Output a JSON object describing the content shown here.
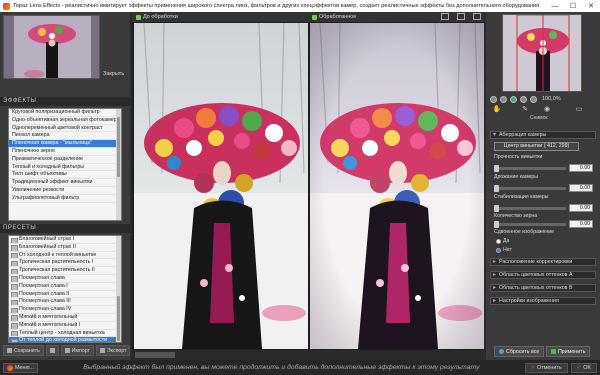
{
  "window": {
    "title": "Topaz Lens Effects - реалистично имитирует эффекты применения широкого спектра линз, фильтров и других спецэффектов камер, создает реалистичные эффекты без дополнительного оборудования.",
    "minimize": "—",
    "maximize": "☐",
    "close": "✕"
  },
  "left": {
    "close_label": "Закрыть",
    "effects_header": "ЭФФЕКТЫ",
    "effects": [
      "Круговой поляризационный фильтр",
      "Одно-объективная зеркальная фотокамера",
      "Однопеременный цветовой контраст",
      "Пинхол камера",
      "Пленочная камера - \"мыльница\"",
      "Пленочное зерно",
      "Призматическое разделение",
      "Теплый и холодный фильтры",
      "Тилт шифт объективы",
      "Традиционный эффект виньетки",
      "Увеличение резкости",
      "Ультрафиолетовый фильтр"
    ],
    "effects_selected": 4,
    "presets_header": "ПРЕСЕТЫ",
    "presets": [
      "Благоговейный страх I",
      "Благоговейный страх II",
      "От холодной к теплой виньетке",
      "Тропическая растительность I",
      "Тропическая растительность II",
      "Посмертная слава",
      "Посмертная слава I",
      "Посмертная слава II",
      "Посмертная слава III",
      "Посмертная слава IV",
      "Мягкий и мечтательный",
      "Мягкий и мечтательный I",
      "Теплый центр - холодная виньетка",
      "От теплой до холодной размытости"
    ],
    "presets_selected": 13,
    "save": "Сохранить",
    "import": "Импорт",
    "export": "Экспорт"
  },
  "center": {
    "tab_before": "До обработки",
    "tab_after": "Обработанное"
  },
  "right": {
    "zoom": "100,0%",
    "snapshot": "Снимок",
    "aberration": "Аберрация камеры",
    "vignette_center": "Центр виньетки ( 412, 299)",
    "vignette_strength_label": "Прочность виньетки",
    "vignette_strength": "0.00",
    "shake_label": "Дрожание камеры",
    "shake": "0.00",
    "stabilize_label": "Стабилизация камеры",
    "stabilize": "0.00",
    "grain_label": "Количество зерна",
    "grain": "0.00",
    "compare_label": "Сдвоенное изображение",
    "yes": "Да",
    "no": "Нет",
    "correction": "Расположение корректировки",
    "region_a": "Область цветовых оттенков A",
    "region_b": "Область цветовых оттенков B",
    "image_settings": "Настройки изображения",
    "reset_all": "Сбросить все",
    "apply": "Применить"
  },
  "status": {
    "menu": "Меню...",
    "message": "Выбранный эффект был применен, вы можете продолжить и добавить дополнительные эффекты к этому результату",
    "cancel": "Отменить",
    "ok": "OK"
  }
}
